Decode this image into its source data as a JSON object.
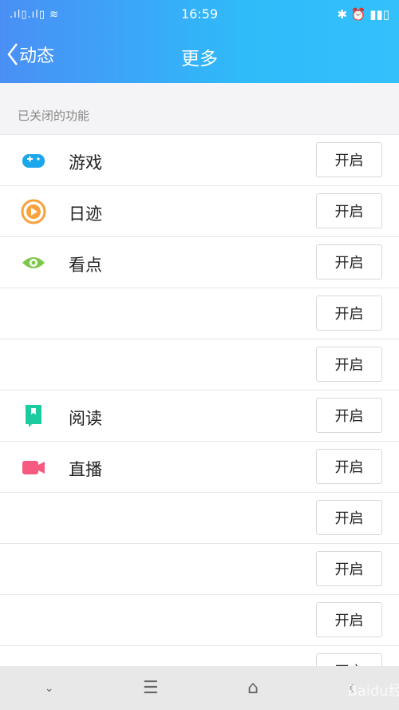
{
  "status": {
    "time": "16:59",
    "left_icons": "signal-icons",
    "right_icons": "bluetooth alarm battery"
  },
  "nav": {
    "back_label": "动态",
    "title": "更多"
  },
  "section_title": "已关闭的功能",
  "items": [
    {
      "label": "游戏",
      "icon": "gamepad-icon",
      "color": "#1aa7ec",
      "button": "开启"
    },
    {
      "label": "日迹",
      "icon": "play-circle-icon",
      "color": "#f7a23b",
      "button": "开启"
    },
    {
      "label": "看点",
      "icon": "eye-icon",
      "color": "#7bc84a",
      "button": "开启"
    },
    {
      "label": "",
      "icon": "",
      "button": "开启"
    },
    {
      "label": "",
      "icon": "",
      "button": "开启"
    },
    {
      "label": "阅读",
      "icon": "book-icon",
      "color": "#1ccca0",
      "button": "开启"
    },
    {
      "label": "直播",
      "icon": "video-camera-icon",
      "color": "#f65a80",
      "button": "开启"
    },
    {
      "label": "",
      "icon": "",
      "button": "开启"
    },
    {
      "label": "",
      "icon": "",
      "button": "开启"
    },
    {
      "label": "",
      "icon": "",
      "button": "开启"
    },
    {
      "label": "",
      "icon": "",
      "button": "开启"
    }
  ],
  "bottom_bar": {
    "watermark": "Baidu经验"
  }
}
